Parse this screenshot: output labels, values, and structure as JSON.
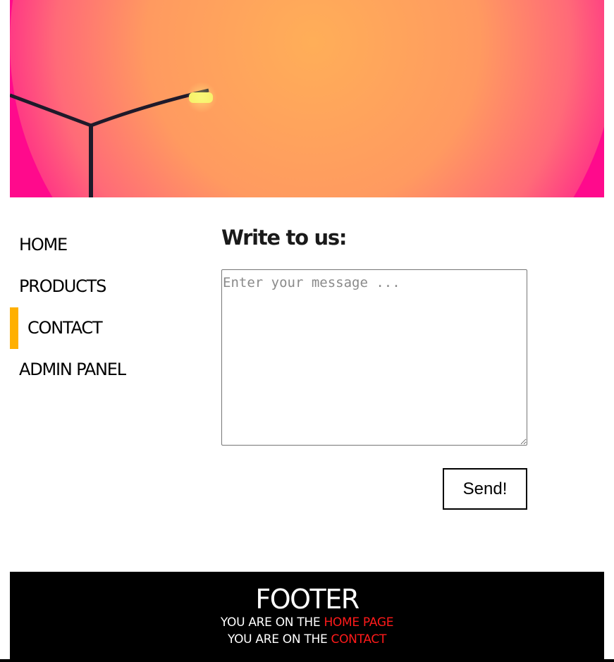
{
  "banner": {
    "image": "sunset-streetlamp-banner",
    "colors": {
      "sky": "#ff0a8c",
      "sun": "#ffa55a"
    }
  },
  "nav": {
    "items": [
      {
        "label": "HOME",
        "active": false
      },
      {
        "label": "PRODUCTS",
        "active": false
      },
      {
        "label": "CONTACT",
        "active": true
      },
      {
        "label": "ADMIN PANEL",
        "active": false
      }
    ],
    "active_color": "#ffb000"
  },
  "main": {
    "title": "Write to us:",
    "message_placeholder": "Enter your message ...",
    "message_value": "",
    "send_label": "Send!"
  },
  "footer": {
    "title": "FOOTER",
    "lines": [
      {
        "prefix": "YOU ARE ON THE",
        "link": "HOME PAGE"
      },
      {
        "prefix": "YOU ARE ON THE",
        "link": "CONTACT"
      }
    ],
    "link_color": "#ff1a1a"
  }
}
